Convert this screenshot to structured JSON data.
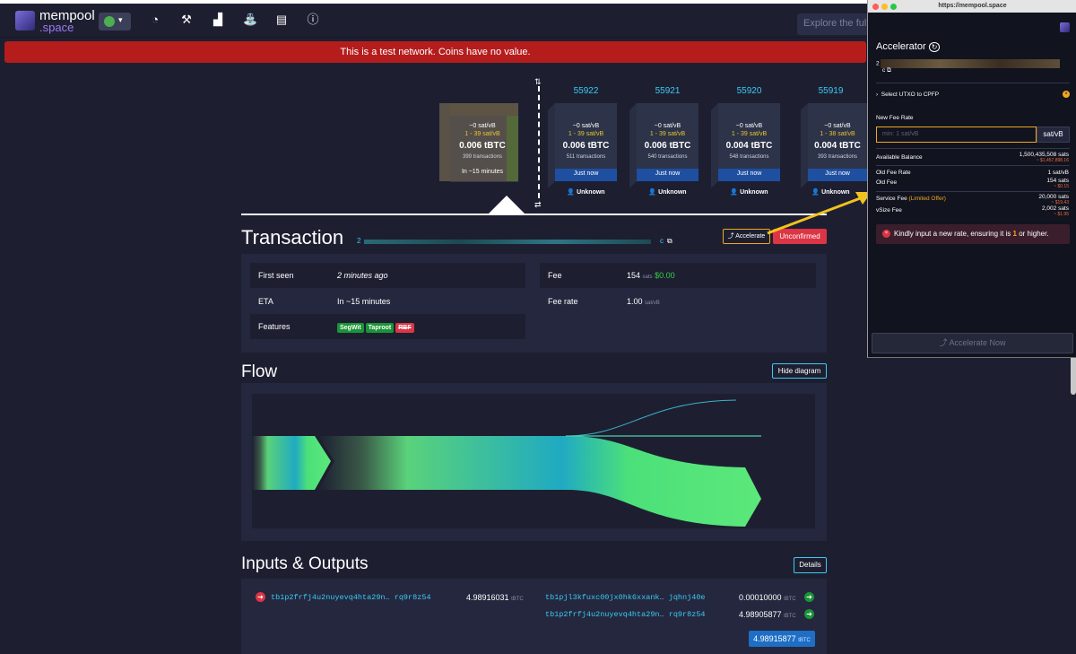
{
  "logo": {
    "line1": "mempool",
    "line2": ".space"
  },
  "search": {
    "placeholder": "Explore the full B"
  },
  "banner": "This is a test network. Coins have no value.",
  "mempool_block": {
    "fee": "~0 sat/vB",
    "range": "1 - 39 sat/vB",
    "size": "0.006 tBTC",
    "txs": "399 transactions",
    "eta": "In ~15 minutes"
  },
  "blocks": [
    {
      "height": "55922",
      "fee": "~0 sat/vB",
      "range": "1 - 39 sat/vB",
      "size": "0.006 tBTC",
      "txs": "511 transactions",
      "time": "Just now",
      "miner": "Unknown"
    },
    {
      "height": "55921",
      "fee": "~0 sat/vB",
      "range": "1 - 39 sat/vB",
      "size": "0.006 tBTC",
      "txs": "540 transactions",
      "time": "Just now",
      "miner": "Unknown"
    },
    {
      "height": "55920",
      "fee": "~0 sat/vB",
      "range": "1 - 39 sat/vB",
      "size": "0.004 tBTC",
      "txs": "548 transactions",
      "time": "Just now",
      "miner": "Unknown"
    },
    {
      "height": "55919",
      "fee": "~0 sat/vB",
      "range": "1 - 38 sat/vB",
      "size": "0.004 tBTC",
      "txs": "393 transactions",
      "time": "Just now",
      "miner": "Unknown"
    }
  ],
  "transaction": {
    "title": "Transaction",
    "txid_start": "2",
    "txid_end": "c",
    "accelerate": "Accelerate",
    "status": "Unconfirmed",
    "first_seen_label": "First seen",
    "first_seen": "2 minutes ago",
    "eta_label": "ETA",
    "eta": "In ~15 minutes",
    "features_label": "Features",
    "features": [
      "SegWit",
      "Taproot",
      "RBF"
    ],
    "fee_label": "Fee",
    "fee": "154",
    "fee_unit": "sats",
    "fee_usd": "$0.00",
    "feerate_label": "Fee rate",
    "feerate": "1.00",
    "feerate_unit": "sat/vB"
  },
  "flow": {
    "title": "Flow",
    "button": "Hide diagram"
  },
  "io": {
    "title": "Inputs & Outputs",
    "button": "Details",
    "input_addr": "tb1p2frfj4u2nuyevq4hta29n… rq9r8z54",
    "input_amt": "4.98916031",
    "outputs": [
      {
        "addr": "tb1pjl3kfuxc00jx0hk6xxank… jqhnj40e",
        "amt": "0.00010000"
      },
      {
        "addr": "tb1p2frfj4u2nuyevq4hta29n… rq9r8z54",
        "amt": "4.98905877"
      }
    ],
    "unit": "tBTC",
    "total": "4.98915877",
    "total_unit": "tBTC"
  },
  "popup": {
    "url": "https://mempool.space",
    "title": "Accelerator",
    "txid_start": "2",
    "txid_end": "c",
    "utxo": "Select UTXO to CPFP",
    "new_fee_rate": "New Fee Rate",
    "placeholder": "min: 1 sat/vB",
    "unit": "sat/vB",
    "available_label": "Available Balance",
    "available": "1,500,435,508 sats",
    "available_usd": "~ $1,457,898.16",
    "old_rate_label": "Old Fee Rate",
    "old_rate": "1 sat/vB",
    "old_fee_label": "Old Fee",
    "old_fee": "154 sats",
    "old_fee_usd": "~ $0.15",
    "service_label": "Service Fee",
    "service_note": "(Limited Offer)",
    "service": "20,000 sats",
    "service_usd": "~ $19.43",
    "vsize_label": "vSize Fee",
    "vsize": "2,002 sats",
    "vsize_usd": "~ $1.95",
    "alert_pre": "Kindly input a new rate, ensuring it is ",
    "alert_num": "1",
    "alert_post": " or higher.",
    "button": "Accelerate Now"
  },
  "colors": {
    "accent": "#3bcaf3",
    "warning": "#f2a81f",
    "danger": "#dc3545",
    "bg": "#1d1f31"
  }
}
